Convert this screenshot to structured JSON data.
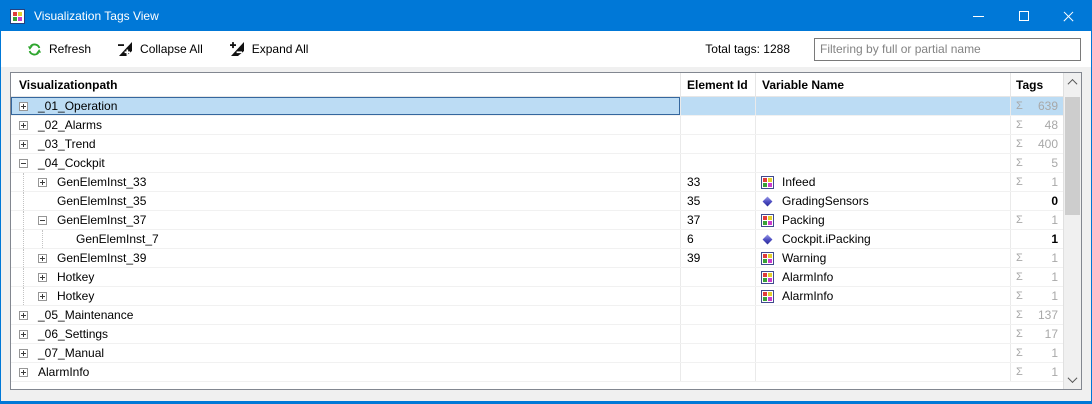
{
  "window": {
    "title": "Visualization Tags View"
  },
  "toolbar": {
    "refresh_label": "Refresh",
    "collapse_all_label": "Collapse All",
    "expand_all_label": "Expand All",
    "total_tags_label": "Total tags: 1288",
    "filter_placeholder": "Filtering by full or partial name"
  },
  "icons": {
    "titlebar": "app-window-icon",
    "refresh": "refresh-circular-arrows-icon",
    "collapse_all": "collapse-all-icon",
    "expand_all": "expand-all-icon",
    "variable_window": "screen-variable-icon",
    "variable_tag": "tag-variable-diamond-icon"
  },
  "colors": {
    "titlebar_accent": "#0078D7",
    "selection_fill": "#BCDCF4",
    "selection_border": "#35679E",
    "summary_gray": "#A8A8A8",
    "refresh_green": "#2DA52D"
  },
  "table": {
    "columns": [
      "Visualizationpath",
      "Element Id",
      "Variable Name",
      "Tags"
    ],
    "sigma_symbol": "Σ",
    "rows": [
      {
        "path": "_01_Operation",
        "level": 0,
        "expander": "plus",
        "element_id": "",
        "var_icon": "",
        "var_name": "",
        "sigma": true,
        "tags": "639",
        "selected": true
      },
      {
        "path": "_02_Alarms",
        "level": 0,
        "expander": "plus",
        "element_id": "",
        "var_icon": "",
        "var_name": "",
        "sigma": true,
        "tags": "48",
        "selected": false
      },
      {
        "path": "_03_Trend",
        "level": 0,
        "expander": "plus",
        "element_id": "",
        "var_icon": "",
        "var_name": "",
        "sigma": true,
        "tags": "400",
        "selected": false
      },
      {
        "path": "_04_Cockpit",
        "level": 0,
        "expander": "minus",
        "element_id": "",
        "var_icon": "",
        "var_name": "",
        "sigma": true,
        "tags": "5",
        "selected": false
      },
      {
        "path": "GenElemInst_33",
        "level": 1,
        "expander": "plus",
        "element_id": "33",
        "var_icon": "window",
        "var_name": "Infeed",
        "sigma": true,
        "tags": "1",
        "selected": false
      },
      {
        "path": "GenElemInst_35",
        "level": 1,
        "expander": "none",
        "element_id": "35",
        "var_icon": "diamond",
        "var_name": "GradingSensors",
        "sigma": false,
        "tags": "0",
        "selected": false
      },
      {
        "path": "GenElemInst_37",
        "level": 1,
        "expander": "minus",
        "element_id": "37",
        "var_icon": "window",
        "var_name": "Packing",
        "sigma": true,
        "tags": "1",
        "selected": false
      },
      {
        "path": "GenElemInst_7",
        "level": 2,
        "expander": "none",
        "element_id": "6",
        "var_icon": "diamond",
        "var_name": "Cockpit.iPacking",
        "sigma": false,
        "tags": "1",
        "selected": false
      },
      {
        "path": "GenElemInst_39",
        "level": 1,
        "expander": "plus",
        "element_id": "39",
        "var_icon": "window",
        "var_name": "Warning",
        "sigma": true,
        "tags": "1",
        "selected": false
      },
      {
        "path": "Hotkey",
        "level": 1,
        "expander": "plus",
        "element_id": "",
        "var_icon": "window",
        "var_name": "AlarmInfo",
        "sigma": true,
        "tags": "1",
        "selected": false
      },
      {
        "path": "Hotkey",
        "level": 1,
        "expander": "plus",
        "element_id": "",
        "var_icon": "window",
        "var_name": "AlarmInfo",
        "sigma": true,
        "tags": "1",
        "selected": false
      },
      {
        "path": "_05_Maintenance",
        "level": 0,
        "expander": "plus",
        "element_id": "",
        "var_icon": "",
        "var_name": "",
        "sigma": true,
        "tags": "137",
        "selected": false
      },
      {
        "path": "_06_Settings",
        "level": 0,
        "expander": "plus",
        "element_id": "",
        "var_icon": "",
        "var_name": "",
        "sigma": true,
        "tags": "17",
        "selected": false
      },
      {
        "path": "_07_Manual",
        "level": 0,
        "expander": "plus",
        "element_id": "",
        "var_icon": "",
        "var_name": "",
        "sigma": true,
        "tags": "1",
        "selected": false
      },
      {
        "path": "AlarmInfo",
        "level": 0,
        "expander": "plus",
        "element_id": "",
        "var_icon": "",
        "var_name": "",
        "sigma": true,
        "tags": "1",
        "selected": false
      }
    ]
  }
}
